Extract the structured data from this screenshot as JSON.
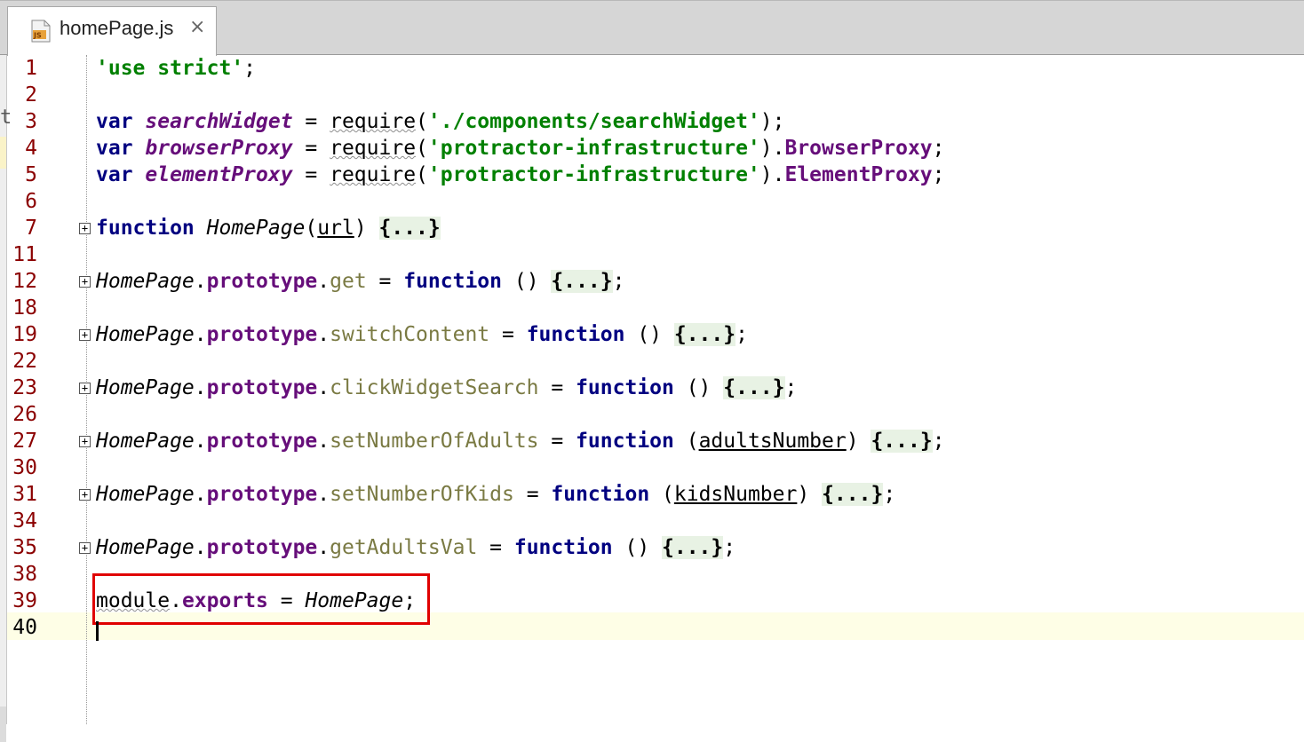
{
  "tab": {
    "filename": "homePage.js",
    "icon": "js-file-icon",
    "close": "×",
    "icon_badge": "JS"
  },
  "left_strip_char": "t",
  "current_line": "40",
  "colors": {
    "keyword": "#000080",
    "string": "#008000",
    "global": "#660e7a",
    "method": "#7a7a43",
    "line_number": "#8b0000",
    "highlight_box": "#e00000"
  },
  "lines": [
    {
      "num": "1",
      "segments": [
        {
          "t": "'use strict'",
          "c": "str"
        },
        {
          "t": ";",
          "c": "plain"
        }
      ]
    },
    {
      "num": "2",
      "segments": []
    },
    {
      "num": "3",
      "segments": [
        {
          "t": "var ",
          "c": "kw"
        },
        {
          "t": "searchWidget",
          "c": "gvar"
        },
        {
          "t": " = ",
          "c": "plain"
        },
        {
          "t": "require",
          "c": "wavy"
        },
        {
          "t": "(",
          "c": "plain"
        },
        {
          "t": "'./components/searchWidget'",
          "c": "str"
        },
        {
          "t": ");",
          "c": "plain"
        }
      ]
    },
    {
      "num": "4",
      "segments": [
        {
          "t": "var ",
          "c": "kw"
        },
        {
          "t": "browserProxy",
          "c": "gvar"
        },
        {
          "t": " = ",
          "c": "plain"
        },
        {
          "t": "require",
          "c": "wavy"
        },
        {
          "t": "(",
          "c": "plain"
        },
        {
          "t": "'protractor-infrastructure'",
          "c": "str"
        },
        {
          "t": ").",
          "c": "plain"
        },
        {
          "t": "BrowserProxy",
          "c": "prop"
        },
        {
          "t": ";",
          "c": "plain"
        }
      ]
    },
    {
      "num": "5",
      "segments": [
        {
          "t": "var ",
          "c": "kw"
        },
        {
          "t": "elementProxy",
          "c": "gvar"
        },
        {
          "t": " = ",
          "c": "plain"
        },
        {
          "t": "require",
          "c": "wavy"
        },
        {
          "t": "(",
          "c": "plain"
        },
        {
          "t": "'protractor-infrastructure'",
          "c": "str"
        },
        {
          "t": ").",
          "c": "plain"
        },
        {
          "t": "ElementProxy",
          "c": "prop"
        },
        {
          "t": ";",
          "c": "plain"
        }
      ]
    },
    {
      "num": "6",
      "segments": []
    },
    {
      "num": "7",
      "fold": true,
      "segments": [
        {
          "t": "function ",
          "c": "kw"
        },
        {
          "t": "HomePage",
          "c": "fnname"
        },
        {
          "t": "(",
          "c": "plain"
        },
        {
          "t": "url",
          "c": "param"
        },
        {
          "t": ") ",
          "c": "plain"
        },
        {
          "t": "{...}",
          "c": "fold-ph"
        }
      ]
    },
    {
      "num": "11",
      "segments": []
    },
    {
      "num": "12",
      "fold": true,
      "segments": [
        {
          "t": "HomePage",
          "c": "fnname"
        },
        {
          "t": ".",
          "c": "plain"
        },
        {
          "t": "prototype",
          "c": "prop"
        },
        {
          "t": ".",
          "c": "plain"
        },
        {
          "t": "get",
          "c": "meth"
        },
        {
          "t": " = ",
          "c": "plain"
        },
        {
          "t": "function",
          "c": "kw"
        },
        {
          "t": " () ",
          "c": "plain"
        },
        {
          "t": "{...}",
          "c": "fold-ph"
        },
        {
          "t": ";",
          "c": "plain"
        }
      ]
    },
    {
      "num": "18",
      "segments": []
    },
    {
      "num": "19",
      "fold": true,
      "segments": [
        {
          "t": "HomePage",
          "c": "fnname"
        },
        {
          "t": ".",
          "c": "plain"
        },
        {
          "t": "prototype",
          "c": "prop"
        },
        {
          "t": ".",
          "c": "plain"
        },
        {
          "t": "switchContent",
          "c": "meth"
        },
        {
          "t": " = ",
          "c": "plain"
        },
        {
          "t": "function",
          "c": "kw"
        },
        {
          "t": " () ",
          "c": "plain"
        },
        {
          "t": "{...}",
          "c": "fold-ph"
        },
        {
          "t": ";",
          "c": "plain"
        }
      ]
    },
    {
      "num": "22",
      "segments": []
    },
    {
      "num": "23",
      "fold": true,
      "segments": [
        {
          "t": "HomePage",
          "c": "fnname"
        },
        {
          "t": ".",
          "c": "plain"
        },
        {
          "t": "prototype",
          "c": "prop"
        },
        {
          "t": ".",
          "c": "plain"
        },
        {
          "t": "clickWidgetSearch",
          "c": "meth"
        },
        {
          "t": " = ",
          "c": "plain"
        },
        {
          "t": "function",
          "c": "kw"
        },
        {
          "t": " () ",
          "c": "plain"
        },
        {
          "t": "{...}",
          "c": "fold-ph"
        },
        {
          "t": ";",
          "c": "plain"
        }
      ]
    },
    {
      "num": "26",
      "segments": []
    },
    {
      "num": "27",
      "fold": true,
      "segments": [
        {
          "t": "HomePage",
          "c": "fnname"
        },
        {
          "t": ".",
          "c": "plain"
        },
        {
          "t": "prototype",
          "c": "prop"
        },
        {
          "t": ".",
          "c": "plain"
        },
        {
          "t": "setNumberOfAdults",
          "c": "meth"
        },
        {
          "t": " = ",
          "c": "plain"
        },
        {
          "t": "function",
          "c": "kw"
        },
        {
          "t": " (",
          "c": "plain"
        },
        {
          "t": "adultsNumber",
          "c": "param"
        },
        {
          "t": ") ",
          "c": "plain"
        },
        {
          "t": "{...}",
          "c": "fold-ph"
        },
        {
          "t": ";",
          "c": "plain"
        }
      ]
    },
    {
      "num": "30",
      "segments": []
    },
    {
      "num": "31",
      "fold": true,
      "segments": [
        {
          "t": "HomePage",
          "c": "fnname"
        },
        {
          "t": ".",
          "c": "plain"
        },
        {
          "t": "prototype",
          "c": "prop"
        },
        {
          "t": ".",
          "c": "plain"
        },
        {
          "t": "setNumberOfKids",
          "c": "meth"
        },
        {
          "t": " = ",
          "c": "plain"
        },
        {
          "t": "function",
          "c": "kw"
        },
        {
          "t": " (",
          "c": "plain"
        },
        {
          "t": "kidsNumber",
          "c": "param"
        },
        {
          "t": ") ",
          "c": "plain"
        },
        {
          "t": "{...}",
          "c": "fold-ph"
        },
        {
          "t": ";",
          "c": "plain"
        }
      ]
    },
    {
      "num": "34",
      "segments": []
    },
    {
      "num": "35",
      "fold": true,
      "segments": [
        {
          "t": "HomePage",
          "c": "fnname"
        },
        {
          "t": ".",
          "c": "plain"
        },
        {
          "t": "prototype",
          "c": "prop"
        },
        {
          "t": ".",
          "c": "plain"
        },
        {
          "t": "getAdultsVal",
          "c": "meth"
        },
        {
          "t": " = ",
          "c": "plain"
        },
        {
          "t": "function",
          "c": "kw"
        },
        {
          "t": " () ",
          "c": "plain"
        },
        {
          "t": "{...}",
          "c": "fold-ph"
        },
        {
          "t": ";",
          "c": "plain"
        }
      ]
    },
    {
      "num": "38",
      "segments": []
    },
    {
      "num": "39",
      "segments": [
        {
          "t": "module",
          "c": "wavy"
        },
        {
          "t": ".",
          "c": "plain"
        },
        {
          "t": "exports",
          "c": "prop"
        },
        {
          "t": " = ",
          "c": "plain"
        },
        {
          "t": "HomePage",
          "c": "fnname"
        },
        {
          "t": ";",
          "c": "plain"
        }
      ]
    },
    {
      "num": "40",
      "segments": []
    }
  ]
}
